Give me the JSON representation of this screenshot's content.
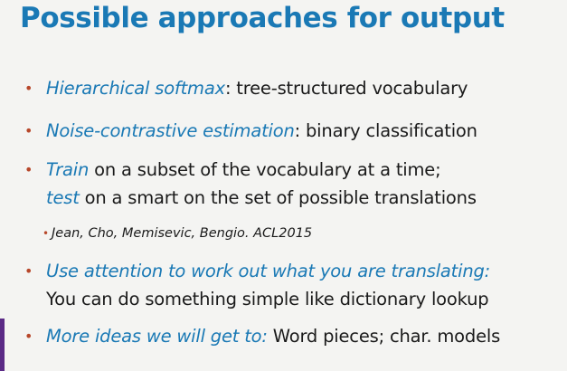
{
  "slide": {
    "title": "Possible approaches for output",
    "bullets": [
      {
        "em": "Hierarchical softmax",
        "rest": ": tree-structured vocabulary"
      },
      {
        "em": "Noise-contrastive estimation",
        "rest": ": binary classification"
      },
      {
        "em": "Train",
        "rest": " on a subset of the vocabulary at a time;",
        "em2": "test",
        "rest2": " on a smart on the set of possible translations"
      },
      {
        "em": "Use attention to work out what you are translating:",
        "line2": "You can do something simple like dictionary lookup"
      },
      {
        "em": "More ideas we will get to:",
        "rest": " Word pieces; char. models"
      }
    ],
    "sub_bullet": "Jean, Cho, Memisevic, Bengio. ACL2015",
    "bullet_char": "•",
    "colors": {
      "title": "#1a79b5",
      "emphasis": "#1a79b5",
      "bullet": "#b7472a",
      "accent": "#5b2a86",
      "background": "#f4f4f2"
    }
  }
}
